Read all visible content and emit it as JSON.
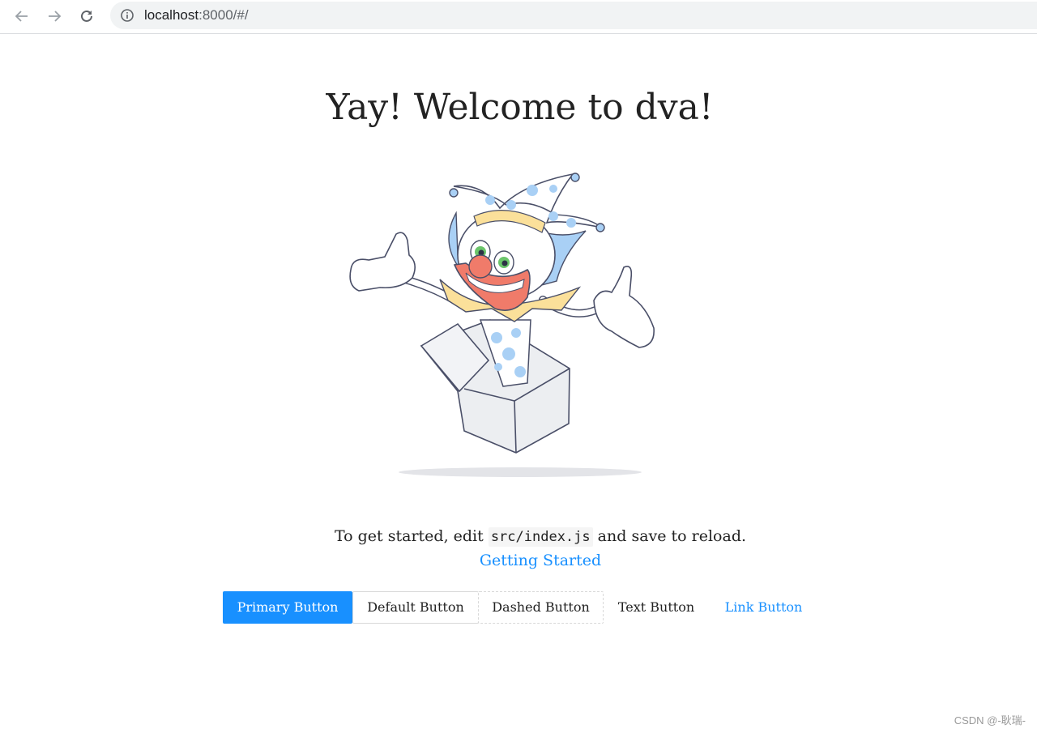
{
  "browser": {
    "url_host": "localhost",
    "url_rest": ":8000/#/",
    "icons": {
      "back": "arrow-left-icon",
      "forward": "arrow-right-icon",
      "reload": "reload-icon",
      "info": "info-icon"
    }
  },
  "page": {
    "title": "Yay! Welcome to dva!",
    "intro_before": "To get started, edit ",
    "intro_code": "src/index.js",
    "intro_after": " and save to reload.",
    "getting_started_link": "Getting Started"
  },
  "buttons": {
    "primary": "Primary Button",
    "default": "Default Button",
    "dashed": "Dashed Button",
    "text": "Text Button",
    "link": "Link Button"
  },
  "colors": {
    "primary": "#1890ff",
    "link": "#1890ff",
    "border": "#d9d9d9"
  },
  "watermark": "CSDN @-耿瑞-"
}
